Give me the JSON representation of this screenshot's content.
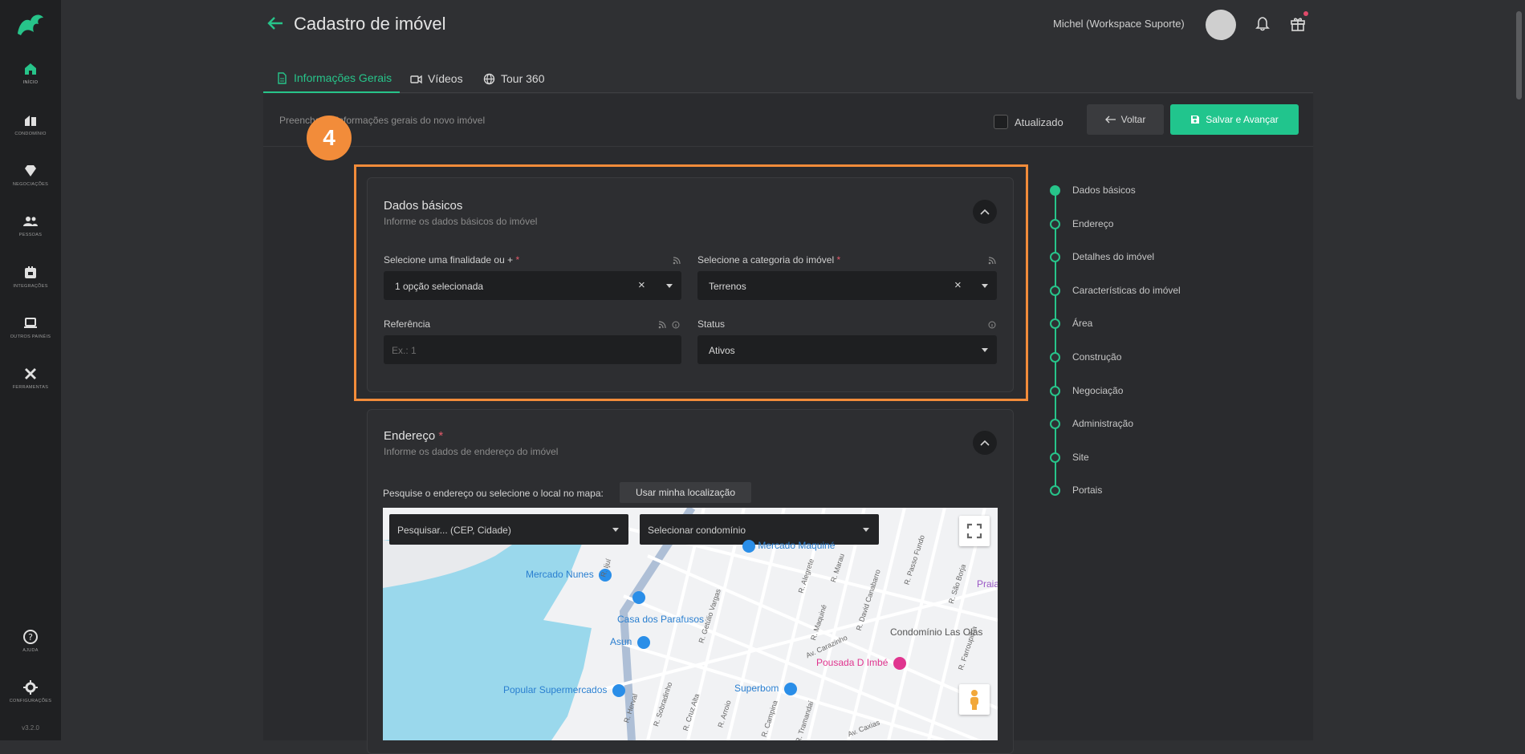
{
  "sidebar": {
    "items": [
      {
        "label": "INÍCIO",
        "icon": "home-icon",
        "active": true
      },
      {
        "label": "CONDOMÍNIO",
        "icon": "building-icon"
      },
      {
        "label": "NEGOCIAÇÕES",
        "icon": "diamond-icon"
      },
      {
        "label": "PESSOAS",
        "icon": "people-icon"
      },
      {
        "label": "INTEGRAÇÕES",
        "icon": "integration-icon"
      },
      {
        "label": "OUTROS PAINÉIS",
        "icon": "laptop-icon"
      },
      {
        "label": "FERRAMENTAS",
        "icon": "tools-icon"
      }
    ],
    "help_label": "AJUDA",
    "settings_label": "CONFIGURAÇÕES",
    "version": "v3.2.0"
  },
  "header": {
    "title": "Cadastro de imóvel",
    "user": "Michel (Workspace Suporte)"
  },
  "tabs": [
    {
      "label": "Informações Gerais",
      "active": true
    },
    {
      "label": "Vídeos"
    },
    {
      "label": "Tour 360"
    }
  ],
  "toolbar": {
    "subtitle": "Preencha as informações gerais do novo imóvel",
    "updated_label": "Atualizado",
    "back_label": "Voltar",
    "save_label": "Salvar e Avançar"
  },
  "annotation": {
    "step": "4"
  },
  "basic": {
    "title": "Dados básicos",
    "desc": "Informe os dados básicos do imóvel",
    "finalidade_label": "Selecione uma finalidade ou +",
    "finalidade_value": "1 opção selecionada",
    "categoria_label": "Selecione a categoria do imóvel",
    "categoria_value": "Terrenos",
    "referencia_label": "Referência",
    "referencia_placeholder": "Ex.: 1",
    "status_label": "Status",
    "status_value": "Ativos"
  },
  "address": {
    "title": "Endereço",
    "desc": "Informe os dados de endereço do imóvel",
    "hint": "Pesquise o endereço ou selecione o local no mapa:",
    "location_button": "Usar minha localização",
    "search_placeholder": "Pesquisar... (CEP, Cidade)",
    "condo_placeholder": "Selecionar condomínio"
  },
  "map": {
    "pois": [
      "Mercado Maquiné",
      "Mercado Nunes",
      "Casa dos Parafusos",
      "Asun",
      "Popular Supermercados",
      "Superbom",
      "Pousada D Imbé"
    ],
    "texts": [
      "Condomínio Las Olas",
      "Praia"
    ],
    "roads": [
      "R. Getúlio Vargas",
      "R. Alegrete",
      "R. Marau",
      "R. Maquiné",
      "R. David Canabarro",
      "R. Passo Fundo",
      "R. São Borja",
      "Av. Carazinho",
      "R. Ijuí",
      "R. Herval",
      "R. Sobradinho",
      "R. Cruz Alta",
      "R. Arroio",
      "R. Campina",
      "R. Tramandaí",
      "Av. Caxias",
      "R. Farroupilha"
    ]
  },
  "steps": [
    "Dados básicos",
    "Endereço",
    "Detalhes do imóvel",
    "Características do imóvel",
    "Área",
    "Construção",
    "Negociação",
    "Administração",
    "Site",
    "Portais"
  ]
}
